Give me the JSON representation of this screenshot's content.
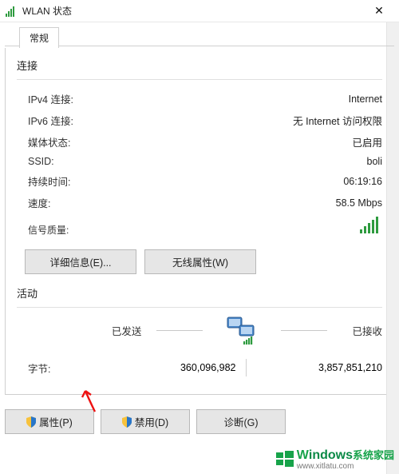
{
  "window": {
    "title": "WLAN 状态",
    "close_glyph": "✕"
  },
  "tabs": {
    "general": "常规"
  },
  "connection": {
    "section_title": "连接",
    "ipv4_label": "IPv4 连接:",
    "ipv4_value": "Internet",
    "ipv6_label": "IPv6 连接:",
    "ipv6_value": "无 Internet 访问权限",
    "media_label": "媒体状态:",
    "media_value": "已启用",
    "ssid_label": "SSID:",
    "ssid_value": "boli",
    "duration_label": "持续时间:",
    "duration_value": "06:19:16",
    "speed_label": "速度:",
    "speed_value": "58.5 Mbps",
    "signal_label": "信号质量:"
  },
  "buttons": {
    "details": "详细信息(E)...",
    "wireless_props": "无线属性(W)",
    "properties": "属性(P)",
    "disable": "禁用(D)",
    "diagnose": "诊断(G)"
  },
  "activity": {
    "section_title": "活动",
    "sent_label": "已发送",
    "recv_label": "已接收",
    "bytes_label": "字节:",
    "bytes_sent": "360,096,982",
    "bytes_recv": "3,857,851,210"
  },
  "watermark": {
    "brand": "indows",
    "slogan": "系统家园",
    "url": "www.xitlatu.com"
  }
}
